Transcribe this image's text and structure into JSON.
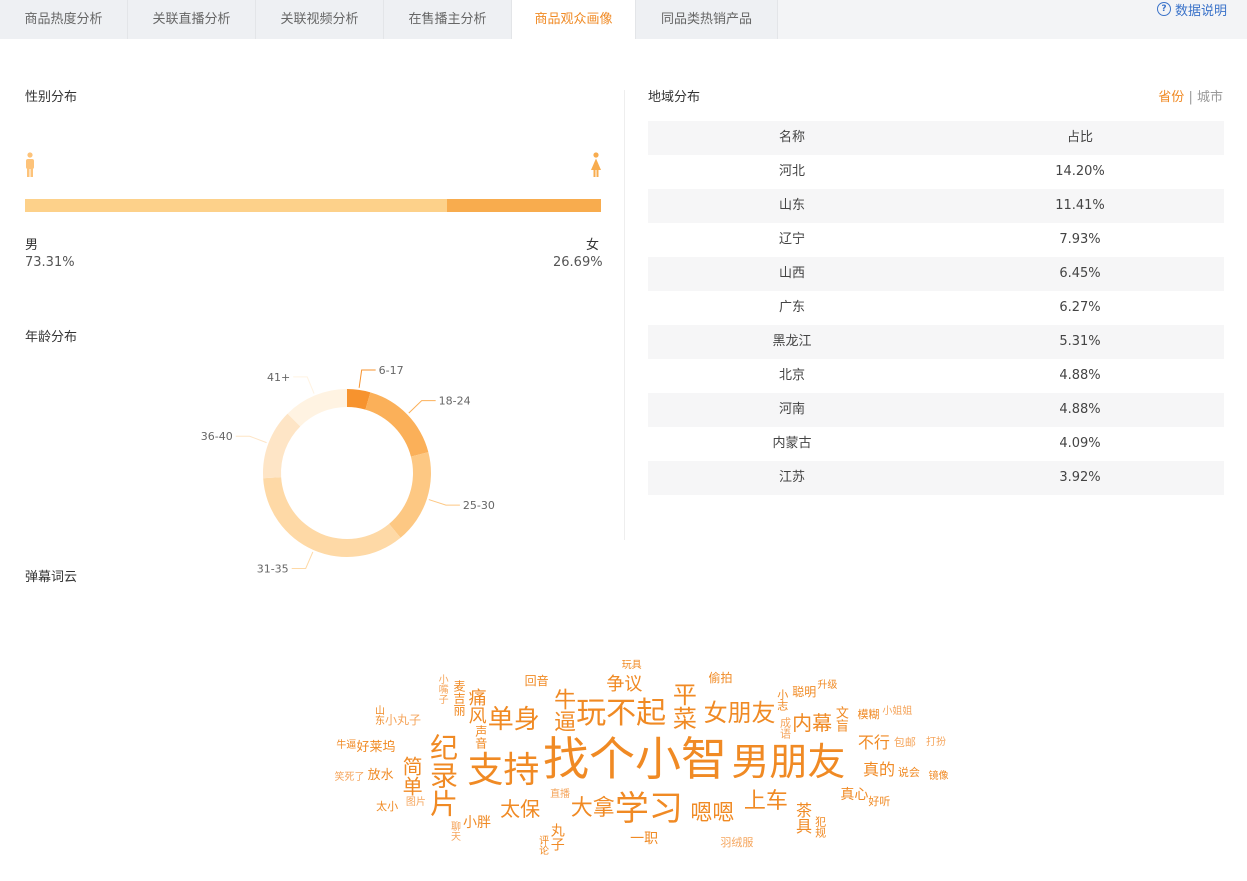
{
  "tabs": [
    {
      "label": "商品热度分析",
      "active": false
    },
    {
      "label": "关联直播分析",
      "active": false
    },
    {
      "label": "关联视频分析",
      "active": false
    },
    {
      "label": "在售播主分析",
      "active": false
    },
    {
      "label": "商品观众画像",
      "active": true
    },
    {
      "label": "同品类热销产品",
      "active": false
    }
  ],
  "help_link": "数据说明",
  "gender": {
    "title": "性别分布",
    "male_label": "男",
    "male_pct": "73.31%",
    "female_label": "女",
    "female_pct": "26.69%",
    "male_share": 0.7331,
    "colors": {
      "male": "#fdd18a",
      "female": "#f8ac4e"
    }
  },
  "age": {
    "title": "年龄分布",
    "chart_data": {
      "type": "pie",
      "donut": true,
      "categories": [
        "6-17",
        "18-24",
        "25-30",
        "31-35",
        "36-40",
        "41+"
      ],
      "values": [
        4.5,
        16.5,
        18.0,
        35.0,
        13.5,
        12.5
      ],
      "colors": [
        "#f7932e",
        "#fbb059",
        "#fdc883",
        "#fed9a6",
        "#fee5c6",
        "#fff3e2"
      ]
    }
  },
  "region": {
    "title": "地域分布",
    "switch": {
      "province": "省份",
      "separator": "|",
      "city": "城市"
    },
    "columns": [
      "名称",
      "占比"
    ],
    "rows": [
      {
        "name": "河北",
        "pct": "14.20%"
      },
      {
        "name": "山东",
        "pct": "11.41%"
      },
      {
        "name": "辽宁",
        "pct": "7.93%"
      },
      {
        "name": "山西",
        "pct": "6.45%"
      },
      {
        "name": "广东",
        "pct": "6.27%"
      },
      {
        "name": "黑龙江",
        "pct": "5.31%"
      },
      {
        "name": "北京",
        "pct": "4.88%"
      },
      {
        "name": "河南",
        "pct": "4.88%"
      },
      {
        "name": "内蒙古",
        "pct": "4.09%"
      },
      {
        "name": "江苏",
        "pct": "3.92%"
      }
    ]
  },
  "wordcloud": {
    "title": "弹幕词云",
    "words": [
      {
        "text": "找个小智",
        "weight": 46,
        "color": "#f08a24"
      },
      {
        "text": "男朋友",
        "weight": 38,
        "color": "#f08a24"
      },
      {
        "text": "支持",
        "weight": 36,
        "color": "#f08a24"
      },
      {
        "text": "学习",
        "weight": 34,
        "color": "#f08a24"
      },
      {
        "text": "玩不起",
        "weight": 30,
        "color": "#f08a24"
      },
      {
        "text": "纪录片",
        "weight": 28,
        "color": "#f08a24"
      },
      {
        "text": "女朋友",
        "weight": 24,
        "color": "#f08a24"
      },
      {
        "text": "单身",
        "weight": 26,
        "color": "#f08a24"
      },
      {
        "text": "平菜",
        "weight": 24,
        "color": "#f08a24"
      },
      {
        "text": "大拿",
        "weight": 22,
        "color": "#f08a24"
      },
      {
        "text": "上车",
        "weight": 22,
        "color": "#f08a24"
      },
      {
        "text": "太保",
        "weight": 20,
        "color": "#f08a24"
      },
      {
        "text": "简单",
        "weight": 20,
        "color": "#f08a24"
      },
      {
        "text": "牛逼",
        "weight": 22,
        "color": "#f08a24"
      },
      {
        "text": "内幕",
        "weight": 20,
        "color": "#f08a24"
      },
      {
        "text": "嗯嗯",
        "weight": 22,
        "color": "#f08a24"
      },
      {
        "text": "争议",
        "weight": 18,
        "color": "#f08a24"
      },
      {
        "text": "痛风",
        "weight": 18,
        "color": "#f08a24"
      },
      {
        "text": "不行",
        "weight": 16,
        "color": "#f08a24"
      },
      {
        "text": "真的",
        "weight": 16,
        "color": "#f08a24"
      },
      {
        "text": "真心",
        "weight": 14,
        "color": "#f08a24"
      },
      {
        "text": "茶具",
        "weight": 16,
        "color": "#f08a24"
      },
      {
        "text": "一职",
        "weight": 14,
        "color": "#f08a24"
      },
      {
        "text": "丸子",
        "weight": 14,
        "color": "#f08a24"
      },
      {
        "text": "小胖",
        "weight": 14,
        "color": "#f08a24"
      },
      {
        "text": "放水",
        "weight": 13,
        "color": "#f08a24"
      },
      {
        "text": "文盲",
        "weight": 13,
        "color": "#f08a24"
      },
      {
        "text": "好莱坞",
        "weight": 13,
        "color": "#f08a24"
      },
      {
        "text": "小丸子",
        "weight": 12,
        "color": "#f5a55c"
      },
      {
        "text": "声音",
        "weight": 12,
        "color": "#f08a24"
      },
      {
        "text": "回音",
        "weight": 12,
        "color": "#f08a24"
      },
      {
        "text": "偷拍",
        "weight": 12,
        "color": "#f08a24"
      },
      {
        "text": "麦吉丽",
        "weight": 12,
        "color": "#f08a24"
      },
      {
        "text": "聪明",
        "weight": 12,
        "color": "#f08a24"
      },
      {
        "text": "模糊",
        "weight": 11,
        "color": "#f08a24"
      },
      {
        "text": "成语",
        "weight": 11,
        "color": "#f5a55c"
      },
      {
        "text": "羽绒服",
        "weight": 11,
        "color": "#f5a55c"
      },
      {
        "text": "包邮",
        "weight": 11,
        "color": "#f5a55c"
      },
      {
        "text": "小志",
        "weight": 11,
        "color": "#f08a24"
      },
      {
        "text": "说会",
        "weight": 11,
        "color": "#f08a24"
      },
      {
        "text": "好听",
        "weight": 11,
        "color": "#f08a24"
      },
      {
        "text": "犯规",
        "weight": 11,
        "color": "#f08a24"
      },
      {
        "text": "直播",
        "weight": 10,
        "color": "#f5a55c"
      },
      {
        "text": "评论",
        "weight": 10,
        "color": "#f08a24"
      },
      {
        "text": "笑死了",
        "weight": 10,
        "color": "#f5a55c"
      },
      {
        "text": "图片",
        "weight": 10,
        "color": "#f5a55c"
      },
      {
        "text": "聊天",
        "weight": 10,
        "color": "#f5a55c"
      },
      {
        "text": "太小",
        "weight": 11,
        "color": "#f08a24"
      },
      {
        "text": "牛逼",
        "weight": 10,
        "color": "#f08a24"
      },
      {
        "text": "玩具",
        "weight": 10,
        "color": "#f08a24"
      },
      {
        "text": "山东",
        "weight": 10,
        "color": "#f08a24"
      },
      {
        "text": "小姐姐",
        "weight": 10,
        "color": "#f5a55c"
      },
      {
        "text": "升级",
        "weight": 10,
        "color": "#f08a24"
      },
      {
        "text": "小嘴子",
        "weight": 10,
        "color": "#f5a55c"
      },
      {
        "text": "打扮",
        "weight": 10,
        "color": "#f5a55c"
      },
      {
        "text": "镜像",
        "weight": 10,
        "color": "#f08a24"
      }
    ]
  }
}
